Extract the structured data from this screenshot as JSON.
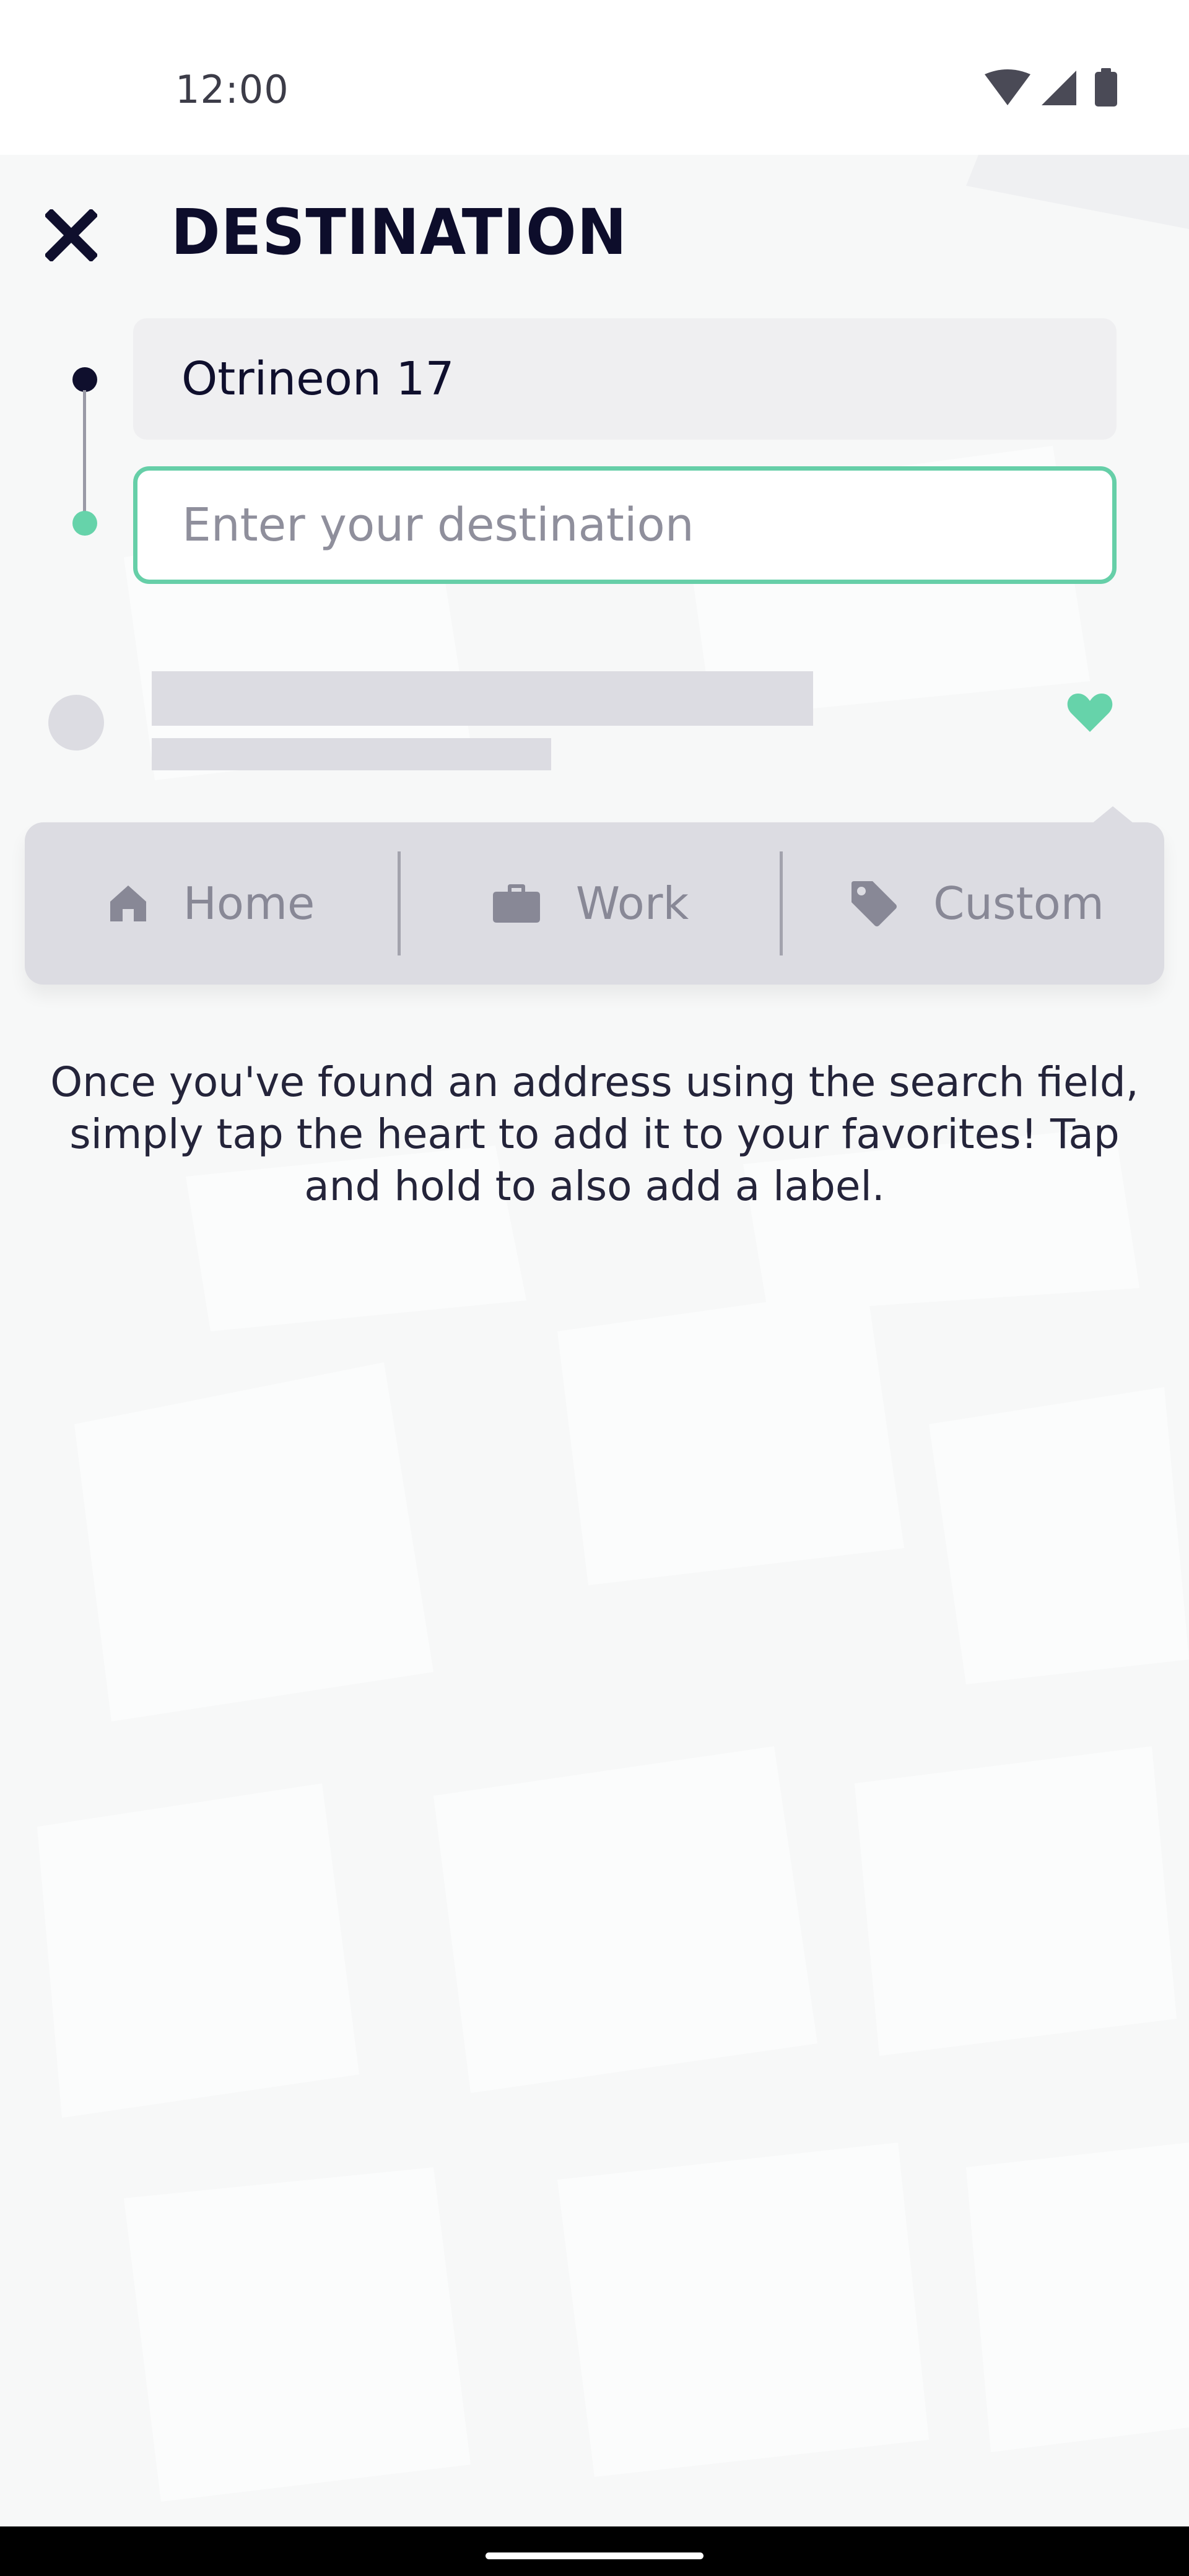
{
  "status_bar": {
    "time": "12:00",
    "icons": [
      "wifi-icon",
      "cellular-signal-icon",
      "battery-icon"
    ]
  },
  "header": {
    "close_icon": "close-icon",
    "title": "DESTINATION"
  },
  "route": {
    "origin_value": "Otrineon 17",
    "destination_value": "",
    "destination_placeholder": "Enter your destination"
  },
  "favorites": {
    "heart_icon": "heart-icon",
    "label_options": [
      {
        "label": "Home",
        "icon": "home-icon"
      },
      {
        "label": "Work",
        "icon": "briefcase-icon"
      },
      {
        "label": "Custom",
        "icon": "tag-icon"
      }
    ]
  },
  "hint": {
    "text": "Once you've found an address using the search field, simply tap the heart to add it to your favorites! Tap and hold to also add a label."
  },
  "colors": {
    "accent": "#66cfa8",
    "text_dark": "#0f0f2d",
    "muted": "#888896",
    "skeleton": "#dcdce2"
  }
}
